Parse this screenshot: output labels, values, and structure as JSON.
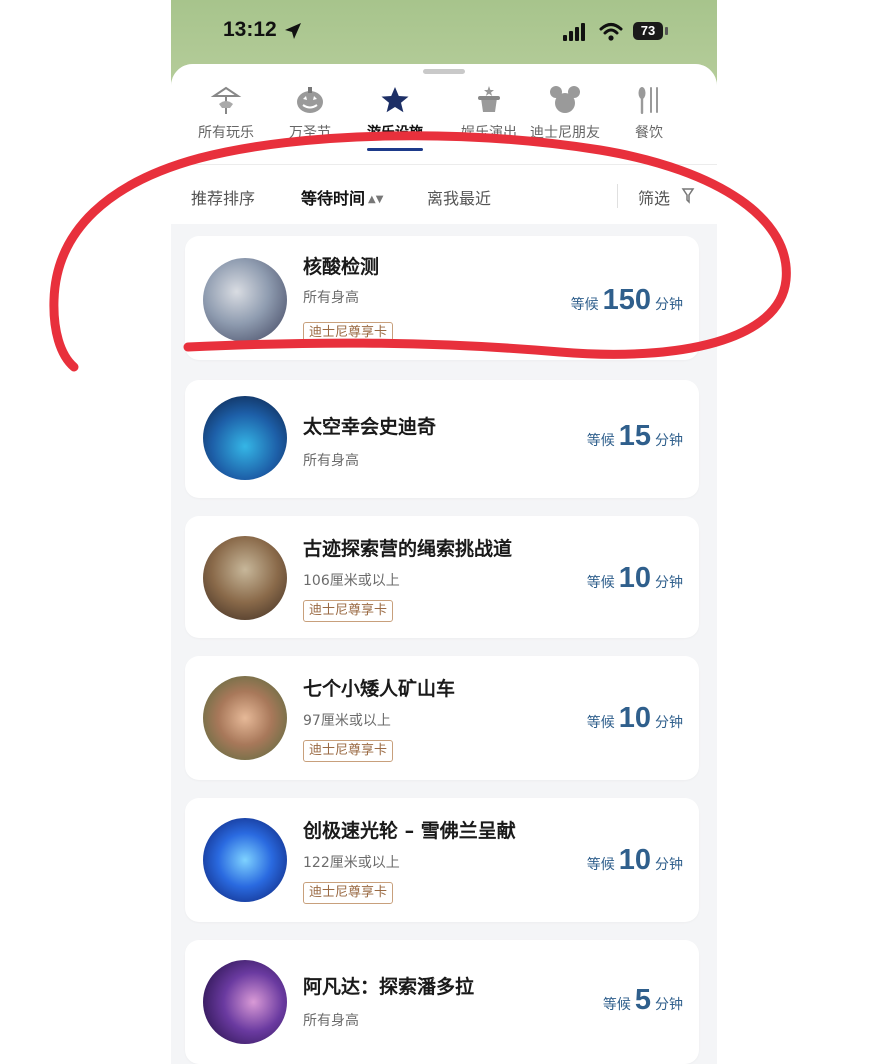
{
  "status_bar": {
    "time": "13:12",
    "battery": "73"
  },
  "categories": [
    {
      "label": "所有玩乐",
      "icon": "carousel-icon"
    },
    {
      "label": "万圣节",
      "icon": "pumpkin-icon"
    },
    {
      "label": "游乐设施",
      "icon": "star-icon",
      "active": true
    },
    {
      "label": "娱乐演出",
      "icon": "magic-hat-icon"
    },
    {
      "label": "迪士尼朋友",
      "icon": "mickey-icon"
    },
    {
      "label": "餐饮",
      "icon": "utensils-icon"
    }
  ],
  "sort_options": [
    "推荐排序",
    "等待时间",
    "离我最近"
  ],
  "filter_label": "筛选",
  "wait_prefix": "等候",
  "wait_unit": "分钟",
  "attractions": [
    {
      "name": "核酸检测",
      "height": "所有身高",
      "badge": "迪士尼尊享卡",
      "wait": "150"
    },
    {
      "name": "太空幸会史迪奇",
      "height": "所有身高",
      "badge": "",
      "wait": "15"
    },
    {
      "name": "古迹探索营的绳索挑战道",
      "height": "106厘米或以上",
      "badge": "迪士尼尊享卡",
      "wait": "10"
    },
    {
      "name": "七个小矮人矿山车",
      "height": "97厘米或以上",
      "badge": "迪士尼尊享卡",
      "wait": "10"
    },
    {
      "name": "创极速光轮 – 雪佛兰呈献",
      "height": "122厘米或以上",
      "badge": "迪士尼尊享卡",
      "wait": "10"
    },
    {
      "name": "阿凡达：探索潘多拉",
      "height": "所有身高",
      "badge": "",
      "wait": "5"
    }
  ],
  "colors": {
    "accent": "#2f5f8c",
    "badge": "#9a6a43",
    "annotation": "#e8303c"
  }
}
